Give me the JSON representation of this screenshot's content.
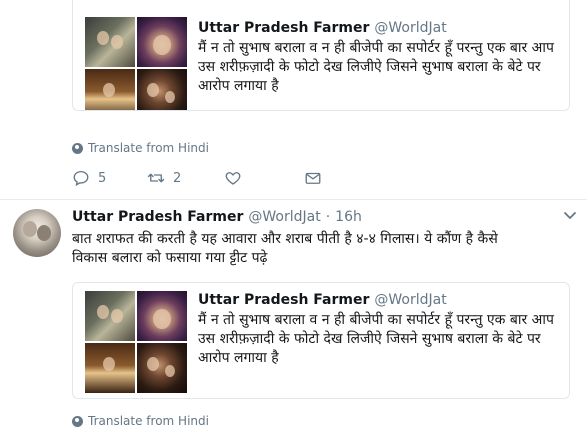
{
  "quoted_tweet": {
    "name": "Uttar Pradesh Farmer",
    "handle": "@WorldJat",
    "text": "मैं न तो सुभाष बराला व न ही बीजेपी का सपोर्टर हूँ परन्तु एक बार आप उस शरीफ़ज़ादी के फोटो देख लिजीऐ जिसने सुभाष बराला के बेटे पर आरोप लगाया है"
  },
  "translate_label": "Translate from Hindi",
  "actions": {
    "reply_count": "5",
    "retweet_count": "2",
    "icons": [
      "reply-icon",
      "retweet-icon",
      "like-icon",
      "direct-message-icon"
    ]
  },
  "tweet": {
    "name": "Uttar Pradesh Farmer",
    "handle": "@WorldJat",
    "separator": "·",
    "time": "16h",
    "text_line1": "बात शराफत की करती है यह आवारा और शराब पीती है ४-४ गिलास। ये कौंण है कैसे",
    "text_line2": "विकास बलारा को फसाया गया ट्टीट पढ़े"
  },
  "colors": {
    "text": "#14171a",
    "secondary": "#657786",
    "border": "#e1e8ed"
  }
}
